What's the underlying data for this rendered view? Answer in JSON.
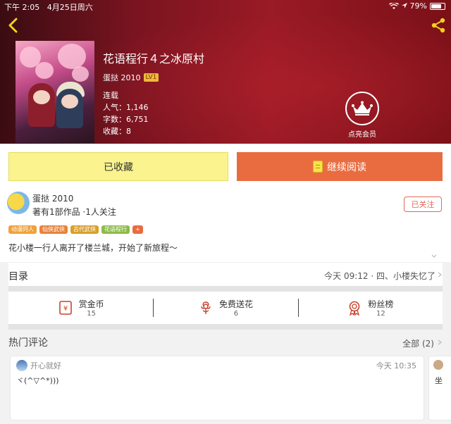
{
  "status_bar": {
    "time": "下午 2:05",
    "date": "4月25日周六",
    "battery": "79%",
    "battery_level": 0.79
  },
  "book": {
    "title": "花语程行４之冰原村",
    "author": "蛋挞 2010",
    "level": "LV1",
    "status": "连载",
    "popularity": "人气：1,146",
    "word_count": "字数：6,751",
    "favorites": "收藏：8"
  },
  "vip": {
    "label": "点亮会员"
  },
  "actions": {
    "favorited_label": "已收藏",
    "continue_label": "继续阅读"
  },
  "author_card": {
    "name": "蛋挞 2010",
    "stats": "著有1部作品 ·1人关注",
    "follow_label": "已关注"
  },
  "tags": [
    {
      "label": "动漫同人",
      "color": "#f0a23a"
    },
    {
      "label": "仙侠武侠",
      "color": "#e8823c"
    },
    {
      "label": "古代武侠",
      "color": "#d9a02c"
    },
    {
      "label": "花语程行",
      "color": "#8dbb4a"
    },
    {
      "label": "+",
      "color": "#e96c40"
    }
  ],
  "summary": "花小楼一行人离开了楼兰城，开始了新旅程～",
  "toc": {
    "label": "目录",
    "latest": "今天 09:12 · 四、小楼失忆了"
  },
  "stats": [
    {
      "label": "赏金币",
      "value": "15",
      "icon": "reward-coin-icon"
    },
    {
      "label": "免费送花",
      "value": "6",
      "icon": "flower-icon"
    },
    {
      "label": "粉丝榜",
      "value": "12",
      "icon": "fan-medal-icon"
    }
  ],
  "comments": {
    "title": "热门评论",
    "all_label": "全部 (2)",
    "items": [
      {
        "user": "开心就好",
        "time": "今天 10:35",
        "text": "ヾ(^▽^*)))"
      },
      {
        "user": "",
        "time": "",
        "text": "坐"
      }
    ]
  },
  "colors": {
    "accent_orange": "#e96c40",
    "favorite_yellow": "#faf38e",
    "header_red": "#9a1a25",
    "stat_icon_red": "#c9432e"
  }
}
